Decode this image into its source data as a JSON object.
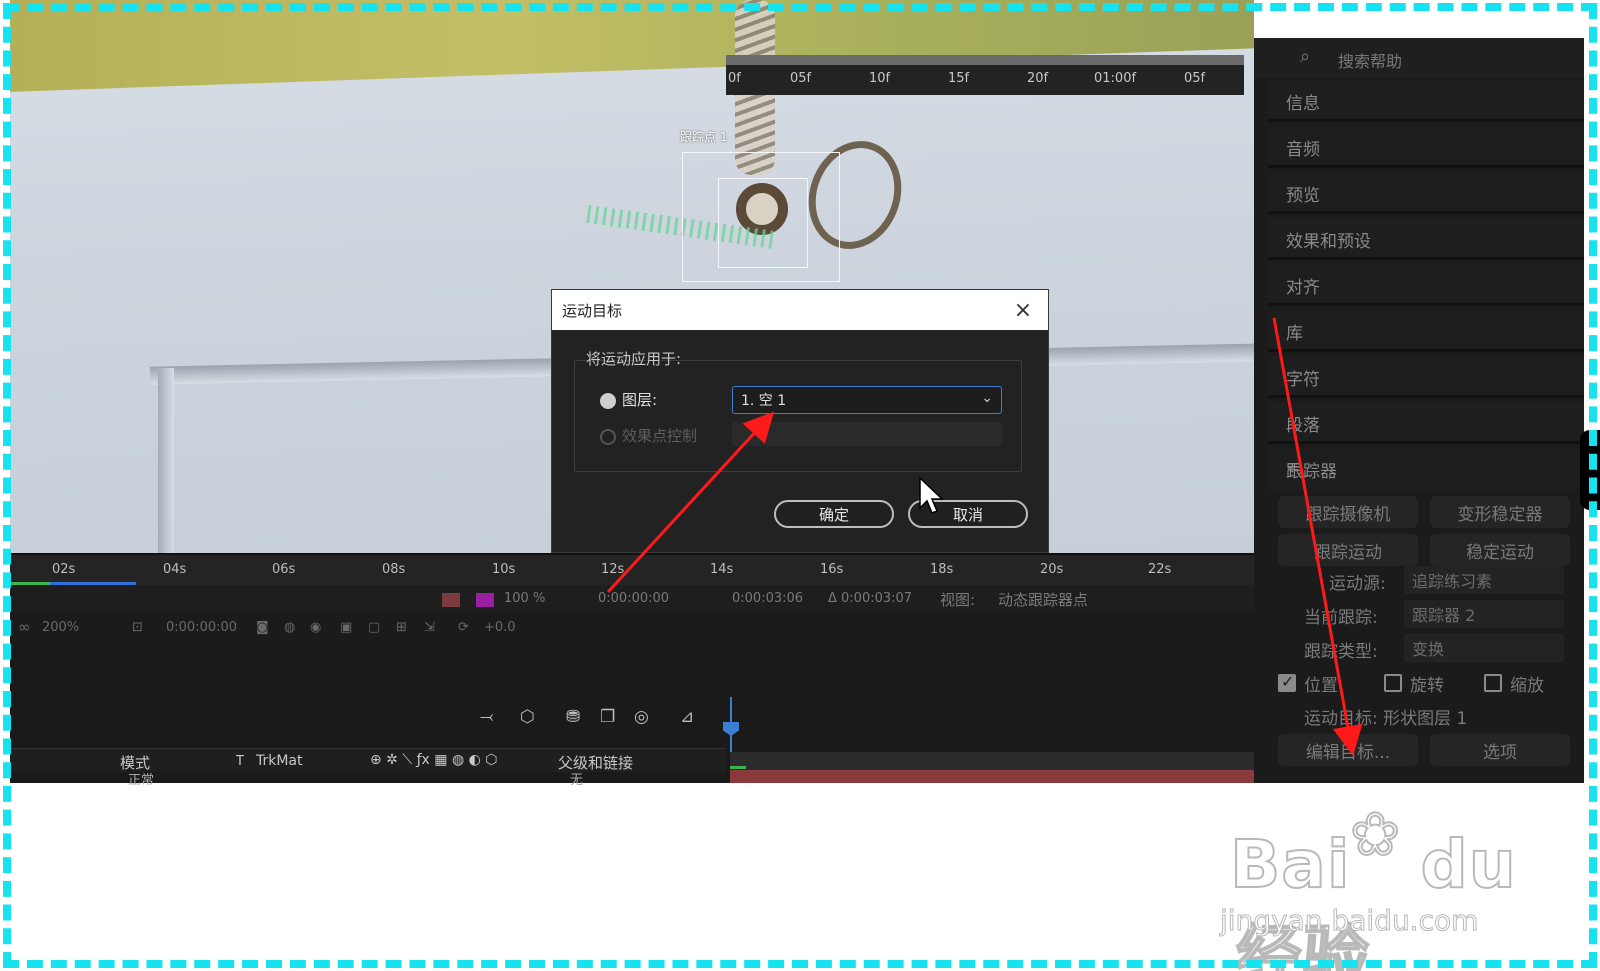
{
  "viewer": {
    "track_point_label": "跟踪点 1"
  },
  "dialog": {
    "title": "运动目标",
    "close": "×",
    "group_label": "将运动应用于:",
    "option_layer": "图层:",
    "option_effect": "效果点控制",
    "layer_value": "1. 空 1",
    "ok": "确定",
    "cancel": "取消"
  },
  "ruler": {
    "ticks": [
      "02s",
      "04s",
      "06s",
      "08s",
      "10s",
      "12s",
      "14s",
      "16s",
      "18s",
      "20s",
      "22s"
    ]
  },
  "viewer_controls": {
    "zoom_pct": "100 %",
    "time_start": "0:00:00:00",
    "time_end": "0:00:03:06",
    "duration": "Δ 0:00:03:07",
    "view_label": "视图:",
    "view_value": "动态跟踪器点",
    "mag": "200%",
    "current_time": "0:00:00:00",
    "exposure": "+0.0"
  },
  "timeline": {
    "ticks": [
      "0f",
      "05f",
      "10f",
      "15f",
      "20f",
      "01:00f",
      "05f"
    ],
    "col_mode": "模式",
    "col_t": "T",
    "col_trkmat": "TrkMat",
    "col_parent": "父级和链接",
    "row_mode": "正常",
    "row_parent": "无"
  },
  "right_panel": {
    "search_placeholder": "搜索帮助",
    "tabs": [
      "信息",
      "音频",
      "预览",
      "效果和预设",
      "对齐",
      "库",
      "字符",
      "段落"
    ],
    "tracker_title": "跟踪器",
    "btn_track_camera": "跟踪摄像机",
    "btn_warp_stabilizer": "变形稳定器",
    "btn_track_motion": "跟踪运动",
    "btn_stabilize_motion": "稳定运动",
    "motion_source_label": "运动源:",
    "motion_source_value": "追踪练习素",
    "current_track_label": "当前跟踪:",
    "current_track_value": "跟踪器 2",
    "track_type_label": "跟踪类型:",
    "track_type_value": "变换",
    "cb_position": "位置",
    "cb_rotation": "旋转",
    "cb_scale": "缩放",
    "motion_target": "运动目标: 形状图层 1",
    "btn_edit_target": "编辑目标...",
    "btn_options": "选项"
  },
  "watermark": {
    "brand": "Bai",
    "brand2": "du",
    "cn": "经验",
    "url": "jingyan.baidu.com"
  },
  "colors": {
    "accent": "#3b7fd4",
    "annotation": "#ff1a1a",
    "frame": "#17e3f0"
  }
}
